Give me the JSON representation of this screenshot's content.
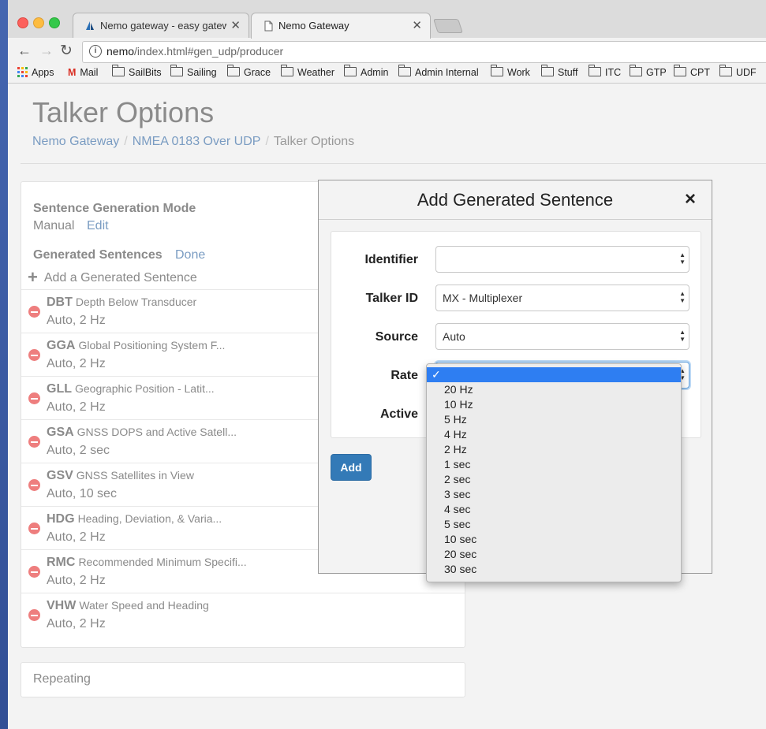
{
  "browser": {
    "tabs": [
      {
        "title": "Nemo gateway - easy gateway"
      },
      {
        "title": "Nemo Gateway"
      }
    ],
    "url_host": "nemo",
    "url_path": "/index.html#gen_udp/producer",
    "bookmarks": [
      "Apps",
      "Mail",
      "SailBits",
      "Sailing",
      "Grace",
      "Weather",
      "Admin",
      "Admin Internal",
      "Work",
      "Stuff",
      "ITC",
      "GTP",
      "CPT",
      "UDF"
    ]
  },
  "page": {
    "title": "Talker Options",
    "breadcrumb": [
      "Nemo Gateway",
      "NMEA 0183 Over UDP",
      "Talker Options"
    ],
    "mode_label": "Sentence Generation Mode",
    "mode_value": "Manual",
    "mode_edit": "Edit",
    "generated_label": "Generated Sentences",
    "generated_done": "Done",
    "add_sentence": "Add a Generated Sentence",
    "sentences": [
      {
        "id": "DBT",
        "desc": "Depth Below Transducer",
        "rate": "Auto, 2 Hz"
      },
      {
        "id": "GGA",
        "desc": "Global Positioning System F...",
        "rate": "Auto, 2 Hz"
      },
      {
        "id": "GLL",
        "desc": "Geographic Position - Latit...",
        "rate": "Auto, 2 Hz"
      },
      {
        "id": "GSA",
        "desc": "GNSS DOPS and Active Satell...",
        "rate": "Auto, 2 sec"
      },
      {
        "id": "GSV",
        "desc": "GNSS Satellites in View",
        "rate": "Auto, 10 sec"
      },
      {
        "id": "HDG",
        "desc": "Heading, Deviation, & Varia...",
        "rate": "Auto, 2 Hz"
      },
      {
        "id": "RMC",
        "desc": "Recommended Minimum Specifi...",
        "rate": "Auto, 2 Hz"
      },
      {
        "id": "VHW",
        "desc": "Water Speed and Heading",
        "rate": "Auto, 2 Hz"
      }
    ],
    "repeating": "Repeating"
  },
  "modal": {
    "title": "Add Generated Sentence",
    "close": "×",
    "fields": {
      "identifier": {
        "label": "Identifier",
        "value": ""
      },
      "talker": {
        "label": "Talker ID",
        "value": "MX - Multiplexer"
      },
      "source": {
        "label": "Source",
        "value": "Auto"
      },
      "rate": {
        "label": "Rate",
        "value": ""
      },
      "active": {
        "label": "Active"
      }
    },
    "add_button": "Add"
  },
  "rate_dropdown": {
    "check": "✓",
    "options": [
      "",
      "20 Hz",
      "10 Hz",
      "5 Hz",
      "4 Hz",
      "2 Hz",
      "1 sec",
      "2 sec",
      "3 sec",
      "4 sec",
      "5 sec",
      "10 sec",
      "20 sec",
      "30 sec"
    ],
    "selected_index": 0
  }
}
